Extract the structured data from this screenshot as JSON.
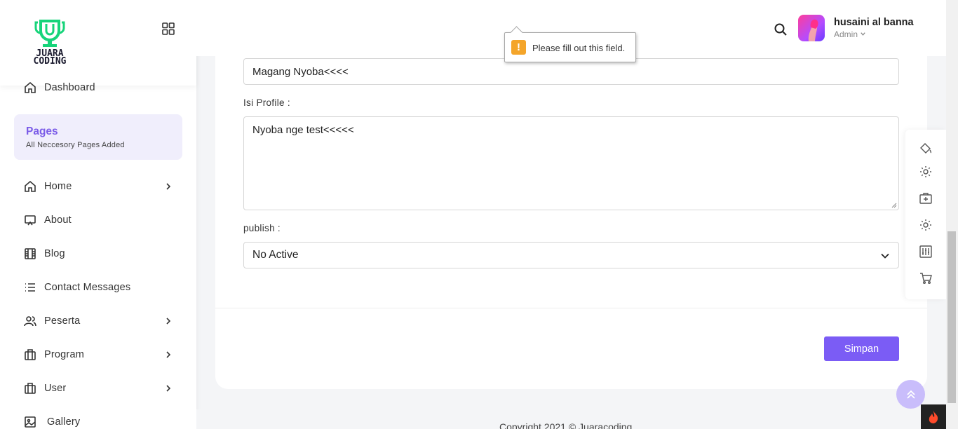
{
  "brand": {
    "logo_text_line1": "JUARA",
    "logo_text_line2": "CODING",
    "accent": "#7b5cf5",
    "logo_color": "#17d47a"
  },
  "sidebar": {
    "dashboard": "Dashboard",
    "pages_title": "Pages",
    "pages_subtitle": "All Neccesory Pages Added",
    "items": [
      {
        "label": "Home",
        "icon": "home-icon",
        "has_children": true
      },
      {
        "label": "About",
        "icon": "monitor-icon",
        "has_children": false
      },
      {
        "label": "Blog",
        "icon": "film-icon",
        "has_children": false
      },
      {
        "label": "Contact Messages",
        "icon": "list-icon",
        "has_children": false
      },
      {
        "label": "Peserta",
        "icon": "users-icon",
        "has_children": true
      },
      {
        "label": "Program",
        "icon": "briefcase-icon",
        "has_children": true
      },
      {
        "label": "User",
        "icon": "briefcase-icon",
        "has_children": true
      },
      {
        "label": "Gallery",
        "icon": "image-icon",
        "has_children": false
      }
    ]
  },
  "header": {
    "user_name": "husaini al banna",
    "user_role": "Admin"
  },
  "form": {
    "title_value": "Magang Nyoba<<<<",
    "profile_label": "Isi Profile :",
    "profile_value": "Nyoba nge test<<<<<",
    "publish_label": "publish :",
    "publish_value": "No Active",
    "save_label": "Simpan"
  },
  "tooltip": {
    "message": "Please fill out this field.",
    "icon": "!"
  },
  "footer": {
    "text": "Copyright 2021 © Juaracoding"
  }
}
